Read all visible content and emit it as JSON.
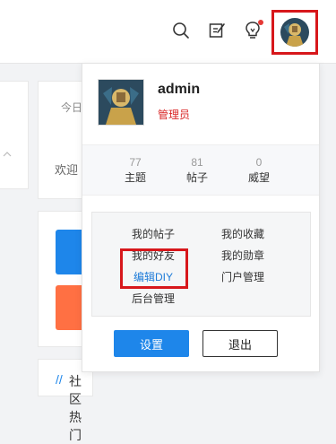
{
  "header": {
    "icons": [
      "search-icon",
      "edit-icon",
      "lightbulb-icon"
    ],
    "notification_dot": true
  },
  "background": {
    "today_label": "今日",
    "welcome_label": "欢迎",
    "hot_title": "社区热门",
    "colors": {
      "blue_btn": "#1e86ea",
      "orange_btn": "#ff7043"
    }
  },
  "user_menu": {
    "username": "admin",
    "role": "管理员",
    "stats": [
      {
        "value": "77",
        "label": "主题"
      },
      {
        "value": "81",
        "label": "帖子"
      },
      {
        "value": "0",
        "label": "威望"
      }
    ],
    "links": [
      {
        "label": "我的帖子",
        "active": false
      },
      {
        "label": "我的收藏",
        "active": false
      },
      {
        "label": "我的好友",
        "active": false
      },
      {
        "label": "我的勋章",
        "active": false
      },
      {
        "label": "编辑DIY",
        "active": true
      },
      {
        "label": "门户管理",
        "active": false
      },
      {
        "label": "后台管理",
        "active": false
      }
    ],
    "settings_label": "设置",
    "logout_label": "退出"
  },
  "colors": {
    "accent": "#1e86ea",
    "role": "#d92626",
    "highlight": "#d7171b"
  }
}
